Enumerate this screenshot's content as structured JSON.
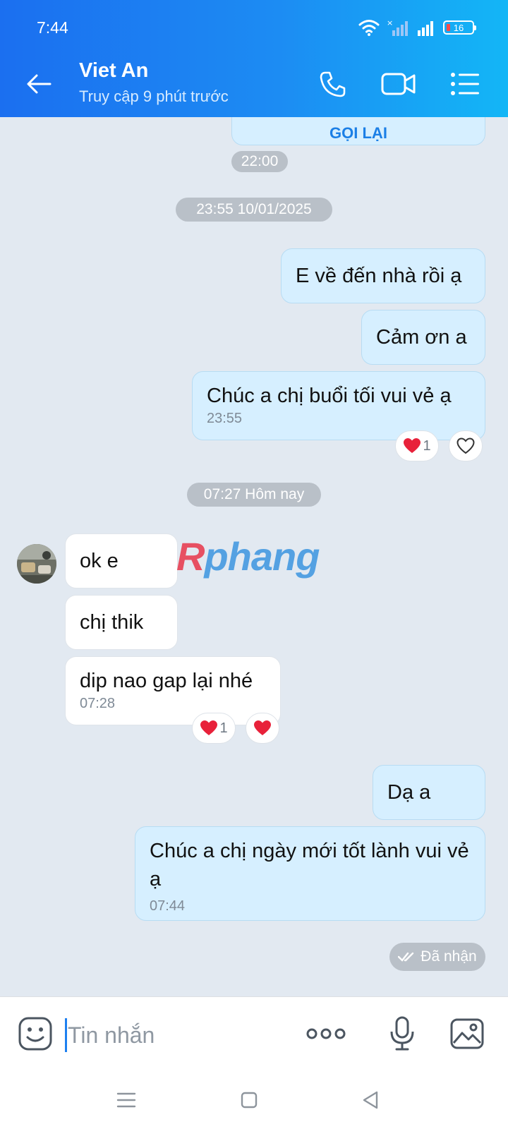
{
  "status_bar": {
    "time": "7:44",
    "battery": "16"
  },
  "header": {
    "contact_name": "Viet An",
    "contact_status": "Truy cập 9 phút trước"
  },
  "chat": {
    "call_back_label": "GỌI LẠI",
    "call_time": "22:00",
    "date_separator_1": "23:55 10/01/2025",
    "date_separator_2": "07:27 Hôm nay",
    "messages": [
      {
        "text": "E về đến nhà rồi ạ"
      },
      {
        "text": "Cảm ơn a"
      },
      {
        "text": "Chúc a chị buổi tối vui vẻ ạ",
        "time": "23:55",
        "reaction_count": "1"
      },
      {
        "text": "ok e"
      },
      {
        "text": "chị thik"
      },
      {
        "text": "dip nao gap lại nhé",
        "time": "07:28",
        "reaction_count": "1"
      },
      {
        "text": "Dạ a"
      },
      {
        "text": "Chúc a chị ngày mới tốt lành vui vẻ ạ",
        "time": "07:44"
      }
    ],
    "delivery_status": "Đã nhận",
    "watermark": "Rphang",
    "colors": {
      "reaction_heart": "#e8213a"
    }
  },
  "composer": {
    "placeholder": "Tin nhắn"
  },
  "icons": {
    "back": "arrow-left-icon",
    "call": "phone-icon",
    "video": "video-camera-icon",
    "menu": "list-menu-icon",
    "emoji": "sticker-emoji-icon",
    "more": "more-dots-icon",
    "mic": "microphone-icon",
    "gallery": "image-gallery-icon"
  }
}
